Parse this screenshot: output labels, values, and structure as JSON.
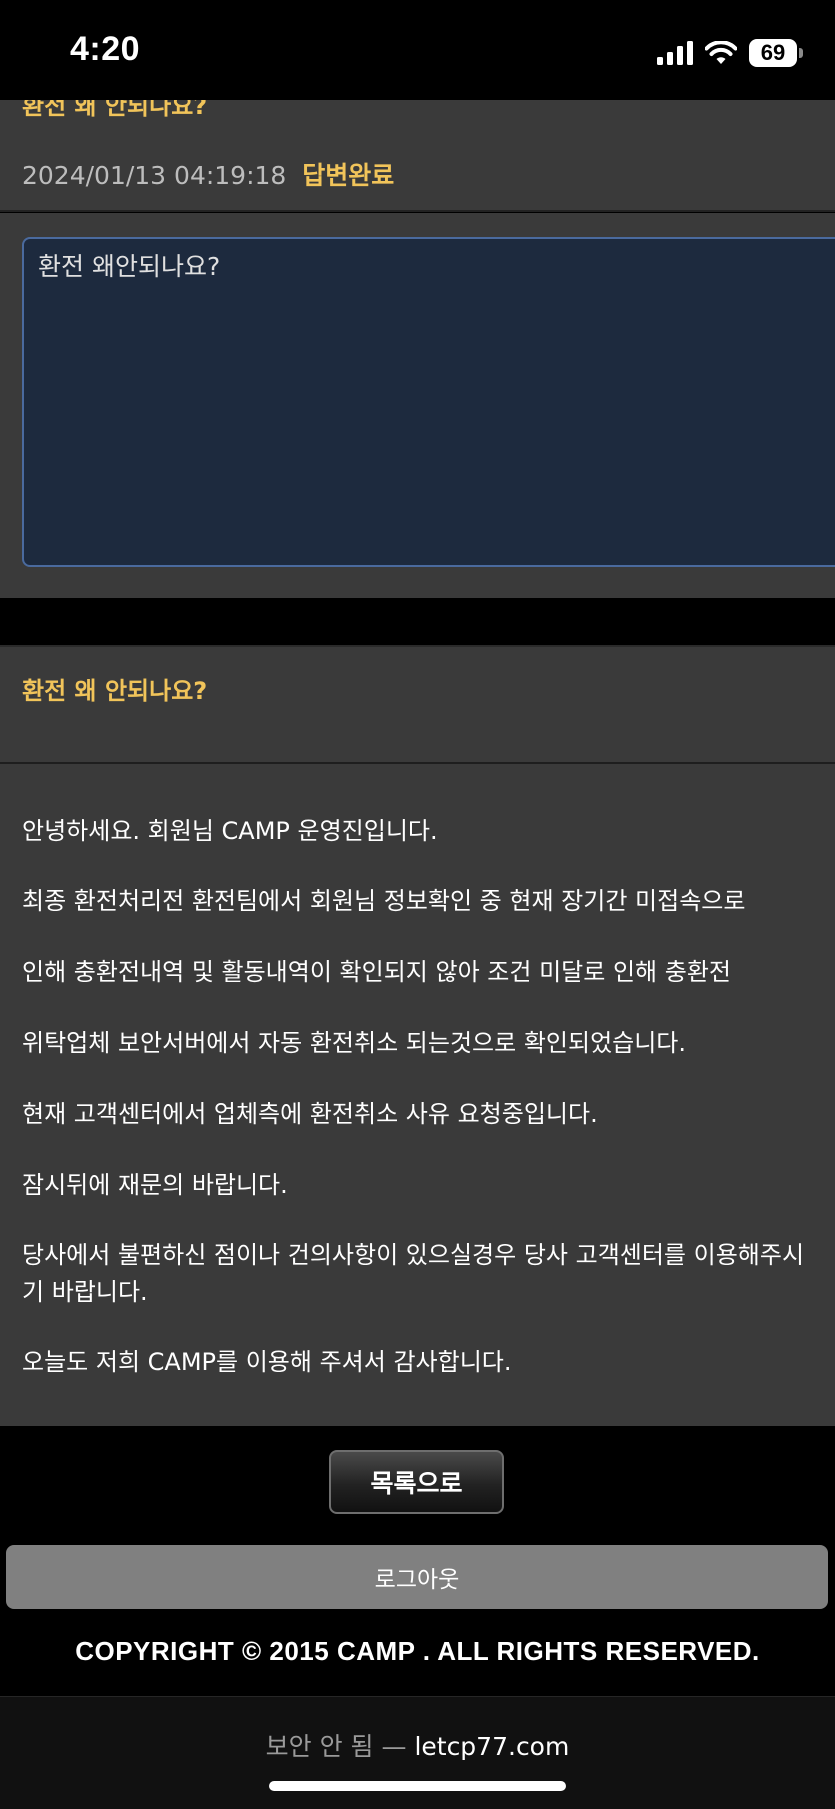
{
  "status_bar": {
    "time": "4:20",
    "battery": "69",
    "icons": [
      "signal-icon",
      "wifi-icon",
      "battery-icon"
    ]
  },
  "question": {
    "title_partial": "환전 왜 안되나요?",
    "datetime": "2024/01/13 04:19:18",
    "status": "답변완료",
    "content": "환전 왜안되나요?"
  },
  "answer": {
    "title": "환전 왜 안되나요?",
    "lines": [
      "안녕하세요. 회원님 CAMP 운영진입니다.",
      "최종 환전처리전 환전팀에서 회원님 정보확인 중 현재 장기간 미접속으로",
      "인해 충환전내역 및 활동내역이 확인되지 않아 조건 미달로 인해 충환전",
      "위탁업체 보안서버에서 자동 환전취소 되는것으로 확인되었습니다.",
      "현재 고객센터에서 업체측에 환전취소 사유 요청중입니다.",
      "잠시뒤에 재문의 바랍니다.",
      "당사에서 불편하신 점이나 건의사항이 있으실경우 당사 고객센터를 이용해주시기 바랍니다.",
      "오늘도 저희 CAMP를 이용해 주셔서 감사합니다."
    ]
  },
  "buttons": {
    "list": "목록으로",
    "logout": "로그아웃"
  },
  "footer": {
    "copyright": "COPYRIGHT © 2015 CAMP . ALL RIGHTS RESERVED."
  },
  "browser": {
    "insecure_label": "보안 안 됨 —",
    "host": "letcp77.com"
  },
  "colors": {
    "accent": "#f1c45a",
    "panel": "#3a3a3a",
    "textarea_bg": "#1d2a3e"
  }
}
